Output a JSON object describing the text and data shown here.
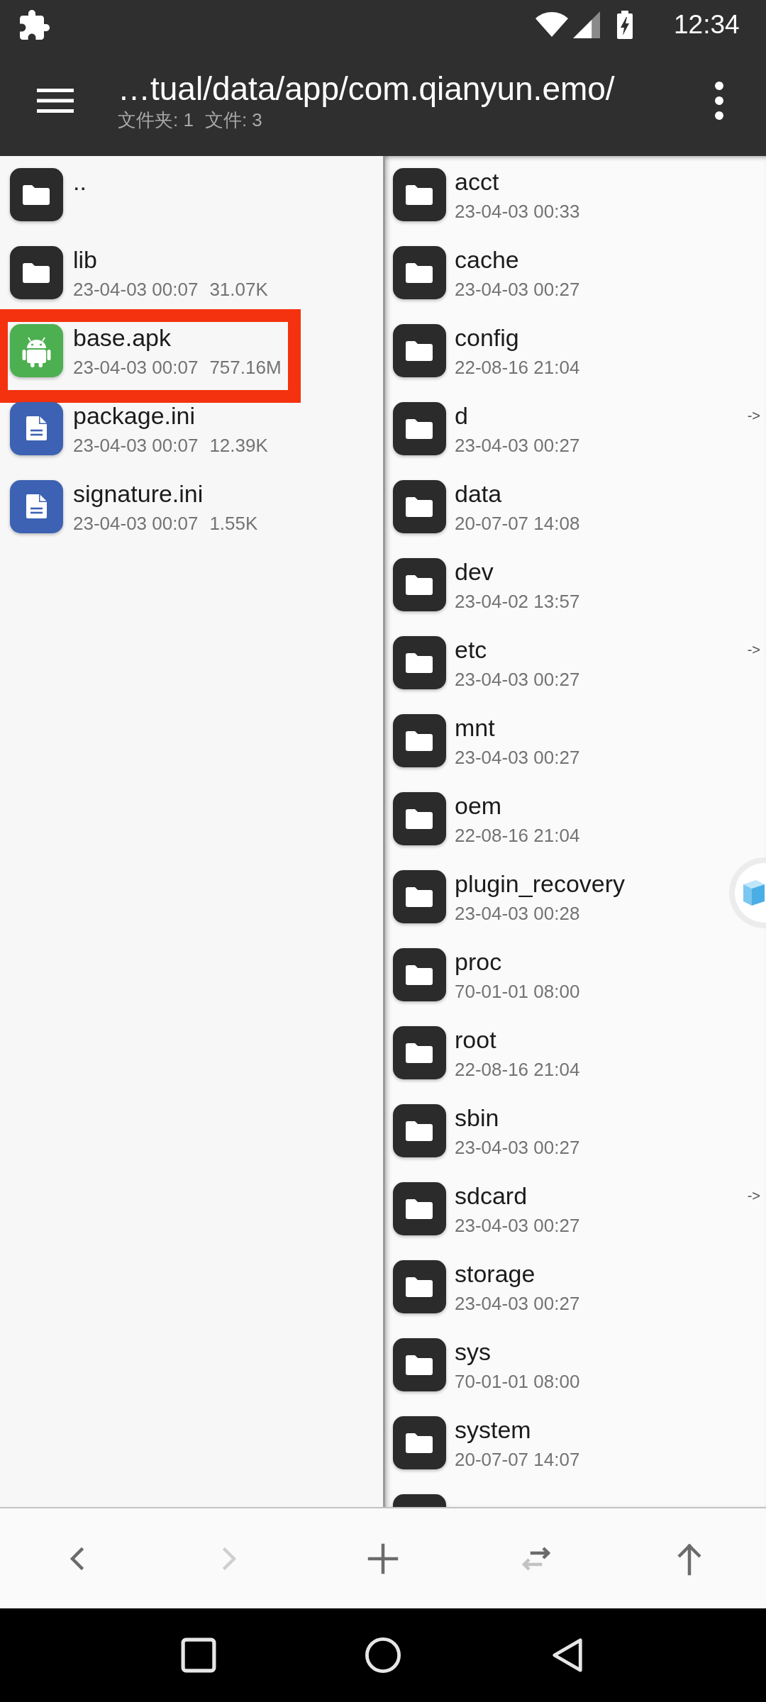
{
  "status_bar": {
    "time": "12:34"
  },
  "app_bar": {
    "path": "…tual/data/app/com.qianyun.emo/",
    "folder_count": "文件夹: 1",
    "file_count": "文件: 3"
  },
  "left_pane": {
    "items": [
      {
        "name": "..",
        "kind": "folder",
        "highlighted": false
      },
      {
        "name": "lib",
        "kind": "folder",
        "date": "23-04-03 00:07",
        "size": "31.07K",
        "highlighted": false
      },
      {
        "name": "base.apk",
        "kind": "apk",
        "date": "23-04-03 00:07",
        "size": "757.16M",
        "highlighted": true
      },
      {
        "name": "package.ini",
        "kind": "text",
        "date": "23-04-03 00:07",
        "size": "12.39K",
        "highlighted": false
      },
      {
        "name": "signature.ini",
        "kind": "text",
        "date": "23-04-03 00:07",
        "size": "1.55K",
        "highlighted": false
      }
    ]
  },
  "right_pane": {
    "items": [
      {
        "name": "acct",
        "kind": "folder",
        "date": "23-04-03 00:33"
      },
      {
        "name": "cache",
        "kind": "folder",
        "date": "23-04-03 00:27"
      },
      {
        "name": "config",
        "kind": "folder",
        "date": "22-08-16 21:04"
      },
      {
        "name": "d",
        "kind": "folder",
        "date": "23-04-03 00:27",
        "link_mark": "->"
      },
      {
        "name": "data",
        "kind": "folder",
        "date": "20-07-07 14:08"
      },
      {
        "name": "dev",
        "kind": "folder",
        "date": "23-04-02 13:57"
      },
      {
        "name": "etc",
        "kind": "folder",
        "date": "23-04-03 00:27",
        "link_mark": "->"
      },
      {
        "name": "mnt",
        "kind": "folder",
        "date": "23-04-03 00:27"
      },
      {
        "name": "oem",
        "kind": "folder",
        "date": "22-08-16 21:04"
      },
      {
        "name": "plugin_recovery",
        "kind": "folder",
        "date": "23-04-03 00:28"
      },
      {
        "name": "proc",
        "kind": "folder",
        "date": "70-01-01 08:00"
      },
      {
        "name": "root",
        "kind": "folder",
        "date": "22-08-16 21:04"
      },
      {
        "name": "sbin",
        "kind": "folder",
        "date": "23-04-03 00:27"
      },
      {
        "name": "sdcard",
        "kind": "folder",
        "date": "23-04-03 00:27",
        "link_mark": "->"
      },
      {
        "name": "storage",
        "kind": "folder",
        "date": "23-04-03 00:27"
      },
      {
        "name": "sys",
        "kind": "folder",
        "date": "70-01-01 08:00"
      },
      {
        "name": "system",
        "kind": "folder",
        "date": "20-07-07 14:07"
      },
      {
        "kind": "folder"
      }
    ]
  },
  "bottom_toolbar": {
    "buttons": [
      {
        "kind": "back",
        "disabled": false
      },
      {
        "kind": "forward",
        "disabled": true
      },
      {
        "kind": "add",
        "disabled": false
      },
      {
        "kind": "swap",
        "disabled": false
      },
      {
        "kind": "up",
        "disabled": false
      }
    ]
  }
}
